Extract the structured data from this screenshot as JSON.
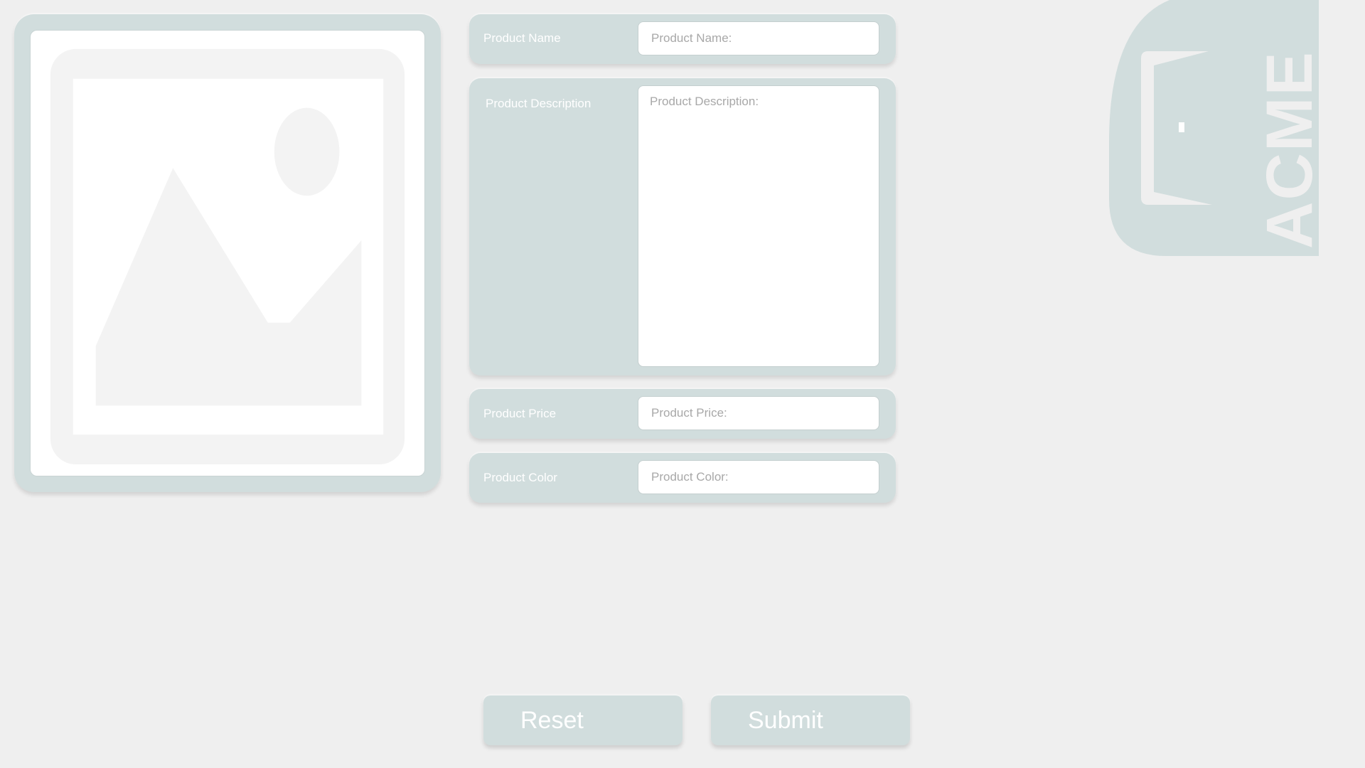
{
  "image_placeholder": {
    "icon": "image-placeholder-icon"
  },
  "form": {
    "name": {
      "label": "Product Name",
      "placeholder": "Product Name:"
    },
    "description": {
      "label": "Product Description",
      "placeholder": "Product Description:"
    },
    "price": {
      "label": "Product Price",
      "placeholder": "Product Price:"
    },
    "color": {
      "label": "Product Color",
      "placeholder": "Product Color:"
    }
  },
  "buttons": {
    "reset_label": "Reset",
    "submit_label": "Submit"
  },
  "logo": {
    "text": "ACME",
    "icon": "acme-logo-icon"
  },
  "colors": {
    "background": "#efefef",
    "panel": "#d1dddd",
    "placeholder_shape": "#f3f3f3"
  }
}
